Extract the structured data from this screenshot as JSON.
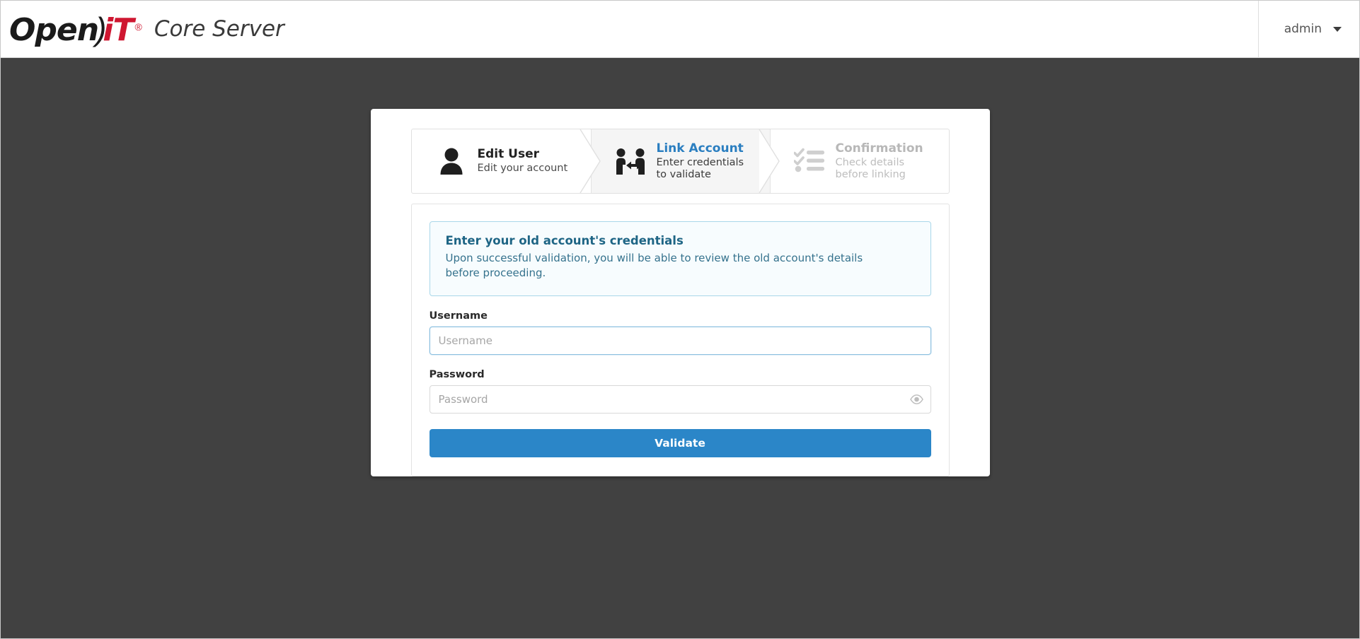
{
  "header": {
    "logo": {
      "word_open": "Open",
      "paren": ")",
      "word_it": "iT",
      "registered": "®",
      "icon_name": "openit-logo"
    },
    "product_name": "Core Server",
    "user_menu": {
      "label": "admin",
      "caret_icon": "chevron-down-icon"
    }
  },
  "wizard": {
    "steps": [
      {
        "title": "Edit User",
        "subtitle": "Edit your account",
        "state": "completed",
        "icon": "user-icon"
      },
      {
        "title": "Link Account",
        "subtitle": "Enter credentials\nto validate",
        "state": "active",
        "icon": "link-accounts-icon"
      },
      {
        "title": "Confirmation",
        "subtitle": "Check details\nbefore linking",
        "state": "upcoming",
        "icon": "checklist-icon"
      }
    ]
  },
  "form": {
    "info": {
      "title": "Enter your old account's credentials",
      "description": "Upon successful validation, you will be able to review the old account's details before proceeding."
    },
    "username": {
      "label": "Username",
      "placeholder": "Username",
      "value": "",
      "focused": true
    },
    "password": {
      "label": "Password",
      "placeholder": "Password",
      "value": "",
      "toggle_icon": "eye-icon"
    },
    "submit_label": "Validate"
  },
  "colors": {
    "page_background": "#414141",
    "accent_blue": "#2b86c8",
    "brand_red": "#cf1731",
    "info_border": "#a9d7e9",
    "info_background": "#f7fcfe",
    "active_step_background": "#f5f5f5"
  }
}
